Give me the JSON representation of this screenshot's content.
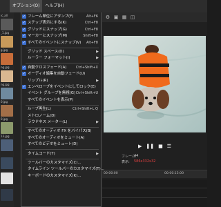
{
  "menubar": {
    "items": [
      "オプション(O)",
      "ヘルプ(H)"
    ]
  },
  "left_strip": {
    "labels": [
      "ic_all",
      "_1.jpg",
      "g.jpg",
      "ng.jpg",
      "ng.jpg",
      "0.jpg",
      "0.jpg",
      "13.jpg"
    ]
  },
  "menu": {
    "items": [
      {
        "label": "フレーム単位にアタンプ(F)",
        "shortcut": "Alt+F6",
        "checked": true
      },
      {
        "label": "ステップ表示にする(K)",
        "shortcut": "Ctrl+F8",
        "checked": true
      },
      {
        "label": "グリッドにスナップ(G)",
        "shortcut": "Ctrl+F8",
        "checked": true
      },
      {
        "label": "マーカーにスナップ(M)",
        "shortcut": "Shift+F8",
        "checked": true
      },
      {
        "label": "すべてのイベントにスナップ(V)",
        "shortcut": "Alt+F8",
        "checked": true
      },
      {
        "label": "グリッド スペース(D)",
        "submenu": true
      },
      {
        "label": "ルーラー フォーマット(I)",
        "submenu": true
      },
      {
        "label": "自動クロスフェード(A)",
        "shortcut": "Ctrl+Shift+X",
        "checked": true
      },
      {
        "label": "オーディオ編集を自動フェード(U)",
        "checked": true
      },
      {
        "label": "リップル(R)",
        "submenu": true
      },
      {
        "label": "エンベロープをイベントにしてロック(E)",
        "checked": true
      },
      {
        "label": "イベント グループを無視(G)",
        "shortcut": "Ctrl+Shift+U"
      },
      {
        "label": "すべてのイベントを表示(P)"
      },
      {
        "label": "ループ再生(L)",
        "shortcut": "Ctrl+Shift+L Q"
      },
      {
        "label": "メトロノーム(D)"
      },
      {
        "label": "ラウドネス メーター(L)",
        "submenu": true
      },
      {
        "label": "すべてのオーディオ FX をバイパス(B)"
      },
      {
        "label": "すべてのオーディオをミュート(A)"
      },
      {
        "label": "すべてのビデオをミュート(D)"
      },
      {
        "label": "タイムコード(T)",
        "submenu": true
      },
      {
        "label": "ツールバーのカスタマイズ(C)..."
      },
      {
        "label": "タイムライン ツールバーのカスタマイズ(T)..."
      },
      {
        "label": "キーボードのカスタマイズ(K)..."
      }
    ]
  },
  "preview_info": {
    "frame_label": "フレーム:",
    "frame_value": "44",
    "display_label": "表示:",
    "display_value": "586x332x32"
  },
  "timeline": {
    "timecodes": [
      "00:00:00",
      "00:00:15:00"
    ]
  },
  "colors": {
    "accent": "#3c6fd0",
    "menu_bg": "#252525",
    "status_red": "#e04040"
  }
}
